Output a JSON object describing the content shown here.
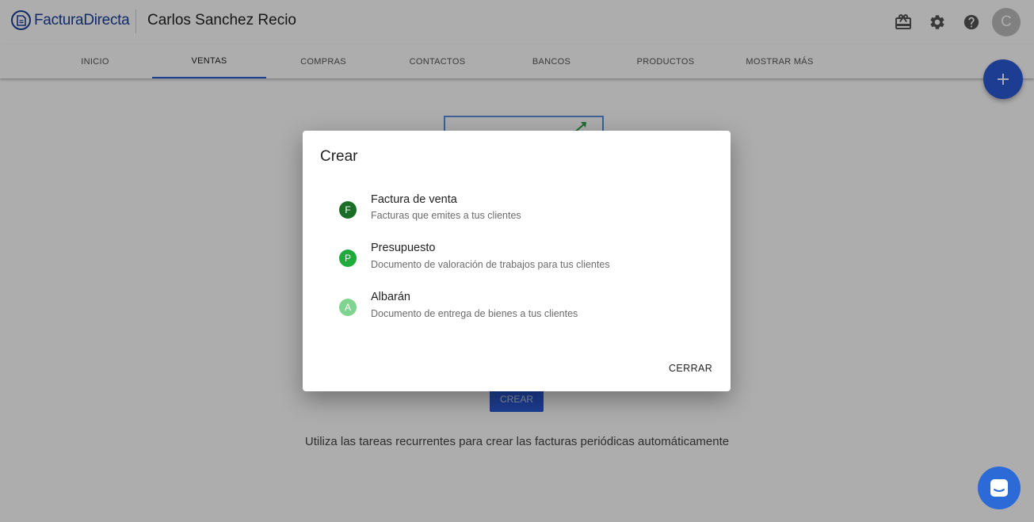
{
  "header": {
    "brand": "FacturaDirecta",
    "company_name": "Carlos Sanchez Recio",
    "avatar_initial": "C",
    "icons": [
      "gift-icon",
      "gear-icon",
      "help-icon"
    ]
  },
  "tabs": [
    {
      "label": "INICIO"
    },
    {
      "label": "VENTAS",
      "active": true
    },
    {
      "label": "COMPRAS"
    },
    {
      "label": "CONTACTOS"
    },
    {
      "label": "BANCOS"
    },
    {
      "label": "PRODUCTOS"
    },
    {
      "label": "MOSTRAR MÁS"
    }
  ],
  "background": {
    "crear_label": "CREAR",
    "hint": "Utiliza las tareas recurrentes para crear las facturas periódicas automáticamente"
  },
  "dialog": {
    "title": "Crear",
    "options": [
      {
        "badge": "F",
        "color": "#1b6e26",
        "title": "Factura de venta",
        "subtitle": "Facturas que emites a tus clientes"
      },
      {
        "badge": "P",
        "color": "#1faa3c",
        "title": "Presupuesto",
        "subtitle": "Documento de valoración de trabajos para tus clientes"
      },
      {
        "badge": "A",
        "color": "#7fd48f",
        "title": "Albarán",
        "subtitle": "Documento de entrega de bienes a tus clientes"
      }
    ],
    "close_label": "CERRAR"
  },
  "colors": {
    "brand": "#1a3e9a",
    "accent": "#2a5bd7"
  }
}
